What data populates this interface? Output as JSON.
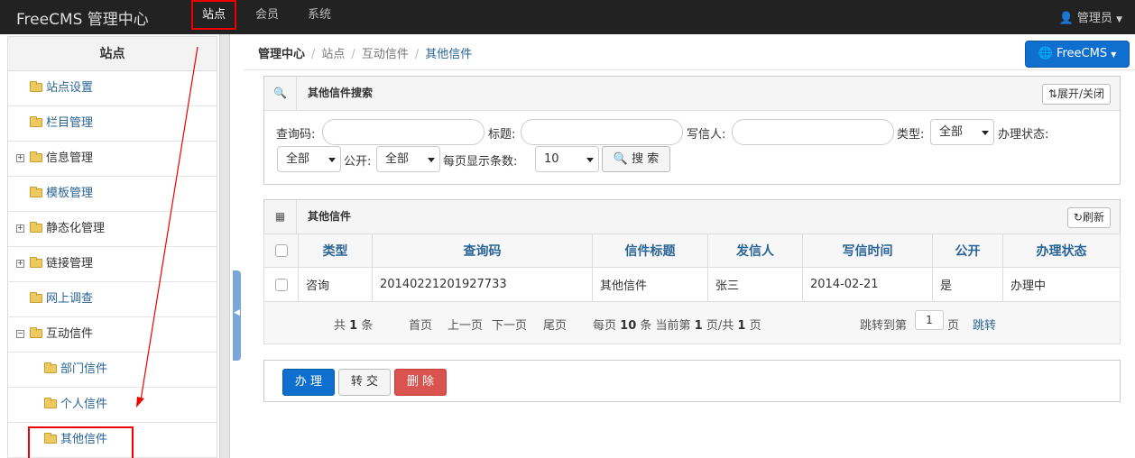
{
  "navbar": {
    "brand": "FreeCMS 管理中心",
    "items": [
      "站点",
      "会员",
      "系统"
    ],
    "user": "管理员"
  },
  "sidebar": {
    "title": "站点",
    "items": [
      {
        "label": "站点设置"
      },
      {
        "label": "栏目管理"
      },
      {
        "label": "信息管理",
        "expander": "+"
      },
      {
        "label": "模板管理"
      },
      {
        "label": "静态化管理",
        "expander": "+"
      },
      {
        "label": "链接管理",
        "expander": "+"
      },
      {
        "label": "网上调查"
      },
      {
        "label": "互动信件",
        "expander": "−"
      },
      {
        "label": "部门信件"
      },
      {
        "label": "个人信件"
      },
      {
        "label": "其他信件"
      }
    ]
  },
  "breadcrumb": {
    "root": "管理中心",
    "items": [
      "站点",
      "互动信件"
    ],
    "current": "其他信件"
  },
  "brand_button": "FreeCMS",
  "search_panel": {
    "title": "其他信件搜索",
    "toggle_label": "展开/关闭",
    "fields": {
      "query_code": "查询码:",
      "title": "标题:",
      "writer": "写信人:",
      "type": "类型:",
      "type_value": "全部",
      "status": "办理状态:",
      "status_value": "全部",
      "public": "公开:",
      "public_value": "全部",
      "page_size": "每页显示条数:",
      "page_size_value": "10"
    },
    "search_label": "搜 索"
  },
  "list_panel": {
    "title": "其他信件",
    "refresh_label": "刷新"
  },
  "table": {
    "headers": [
      "类型",
      "查询码",
      "信件标题",
      "发信人",
      "写信时间",
      "公开",
      "办理状态"
    ],
    "rows": [
      [
        "咨询",
        "20140221201927733",
        "其他信件",
        "张三",
        "2014-02-21",
        "是",
        "办理中"
      ]
    ]
  },
  "pager": {
    "total_prefix": "共",
    "total": "1",
    "total_suffix": "条",
    "first": "首页",
    "prev": "上一页",
    "next": "下一页",
    "last": "尾页",
    "per_page_prefix": "每页",
    "per_page": "10",
    "per_page_mid": "条 当前第",
    "current": "1",
    "page_of": "页/共",
    "pages": "1",
    "page_suffix": "页",
    "jump_prefix": "跳转到第",
    "jump_value": "1",
    "jump_suffix": "页",
    "jump_button": "跳转"
  },
  "actions": {
    "handle": "办 理",
    "transfer": "转 交",
    "delete": "删 除"
  },
  "colors": {
    "accent": "#0f6fcf",
    "link": "#2a6496",
    "danger": "#d9534f",
    "highlight": "#ee0000"
  }
}
